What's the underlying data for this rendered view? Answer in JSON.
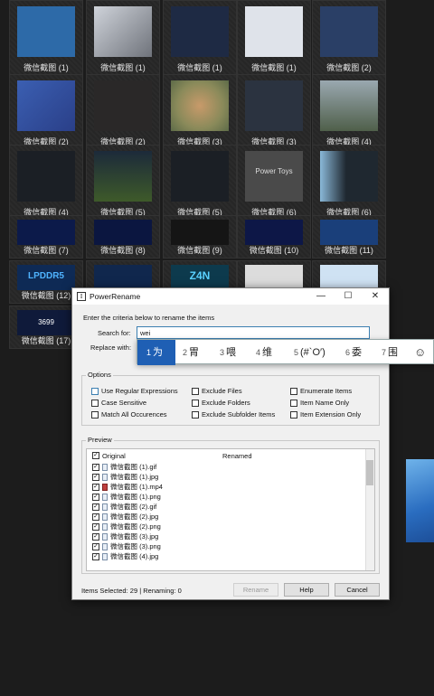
{
  "tiles": [
    {
      "caption": "微信截图 (1)",
      "color": "#2d6aa8"
    },
    {
      "caption": "微信截图 (1)",
      "color": "#8a8e96"
    },
    {
      "caption": "微信截图 (1)",
      "color": "#1e2a44"
    },
    {
      "caption": "微信截图 (1)",
      "color": "#dfe3ea"
    },
    {
      "caption": "微信截图 (2)",
      "color": "#2a3f66"
    },
    {
      "caption": "微信截图 (2)",
      "color": "#3b5fb2"
    },
    {
      "caption": "微信截图 (2)",
      "color": "#3a3634"
    },
    {
      "caption": "微信截图 (3)",
      "color": "#a8a276"
    },
    {
      "caption": "微信截图 (3)",
      "color": "#2b3340"
    },
    {
      "caption": "微信截图 (4)",
      "color": "#6d7d86"
    },
    {
      "caption": "微信截图 (4)",
      "color": "#1b1f25"
    },
    {
      "caption": "微信截图 (5)",
      "color": "#2e4a26"
    },
    {
      "caption": "微信截图 (5)",
      "color": "#1b1f25"
    },
    {
      "caption": "微信截图 (6)",
      "color": "#4a4a4a"
    },
    {
      "caption": "微信截图 (6)",
      "color": "#1f2830"
    },
    {
      "caption": "微信截图 (7)",
      "color": "#0c1a4a"
    },
    {
      "caption": "微信截图 (8)",
      "color": "#0b1640"
    },
    {
      "caption": "微信截图 (9)",
      "color": "#151515"
    },
    {
      "caption": "微信截图 (10)",
      "color": "#0d1747"
    },
    {
      "caption": "微信截图 (11)",
      "color": "#1a3f7a"
    },
    {
      "caption": "微信截图 (12)",
      "color": "#0e2a55"
    },
    {
      "caption": "",
      "color": "#10274d"
    },
    {
      "caption": "",
      "color": "#0d3a4d"
    },
    {
      "caption": "",
      "color": "#dcdcdc"
    },
    {
      "caption": "",
      "color": "#cfe2f3"
    },
    {
      "caption": "微信截图 (17)",
      "color": "#0f1a3a"
    }
  ],
  "tile_texts": {
    "power_toys": "Power Toys",
    "lpddr5": "LPDDR5",
    "z4n": "Z4N",
    "value_3699": "3699"
  },
  "dialog": {
    "title": "PowerRename",
    "minimize": "—",
    "maximize": "☐",
    "close": "✕",
    "intro": "Enter the criteria below to rename the items",
    "search_label": "Search for:",
    "search_value": "wei",
    "replace_label": "Replace with:",
    "options_title": "Options",
    "options": [
      {
        "label": "Use Regular Expressions",
        "checked": false
      },
      {
        "label": "Case Sensitive",
        "checked": false
      },
      {
        "label": "Match All Occurences",
        "checked": false
      },
      {
        "label": "Exclude Files",
        "checked": false
      },
      {
        "label": "Exclude Folders",
        "checked": false
      },
      {
        "label": "Exclude Subfolder Items",
        "checked": false
      },
      {
        "label": "Enumerate Items",
        "checked": false
      },
      {
        "label": "Item Name Only",
        "checked": false
      },
      {
        "label": "Item Extension Only",
        "checked": false
      }
    ],
    "preview_title": "Preview",
    "col_original": "Original",
    "col_renamed": "Renamed",
    "files": [
      {
        "name": "微信截图 (1).gif",
        "checked": true
      },
      {
        "name": "微信截图 (1).jpg",
        "checked": true
      },
      {
        "name": "微信截图 (1).mp4",
        "checked": true
      },
      {
        "name": "微信截图 (1).png",
        "checked": true
      },
      {
        "name": "微信截图 (2).gif",
        "checked": true
      },
      {
        "name": "微信截图 (2).jpg",
        "checked": true
      },
      {
        "name": "微信截图 (2).png",
        "checked": true
      },
      {
        "name": "微信截图 (3).jpg",
        "checked": true
      },
      {
        "name": "微信截图 (3).png",
        "checked": true
      },
      {
        "name": "微信截图 (4).jpg",
        "checked": true
      }
    ],
    "status": "Items Selected: 29 | Renaming: 0",
    "rename_btn": "Rename",
    "help_btn": "Help",
    "cancel_btn": "Cancel"
  },
  "ime": {
    "candidates": [
      {
        "num": "1",
        "text": "为"
      },
      {
        "num": "2",
        "text": "胃"
      },
      {
        "num": "3",
        "text": "喂"
      },
      {
        "num": "4",
        "text": "维"
      },
      {
        "num": "5",
        "text": "(#`O′)"
      },
      {
        "num": "6",
        "text": "委"
      },
      {
        "num": "7",
        "text": "围"
      }
    ],
    "emoji": "☺"
  }
}
